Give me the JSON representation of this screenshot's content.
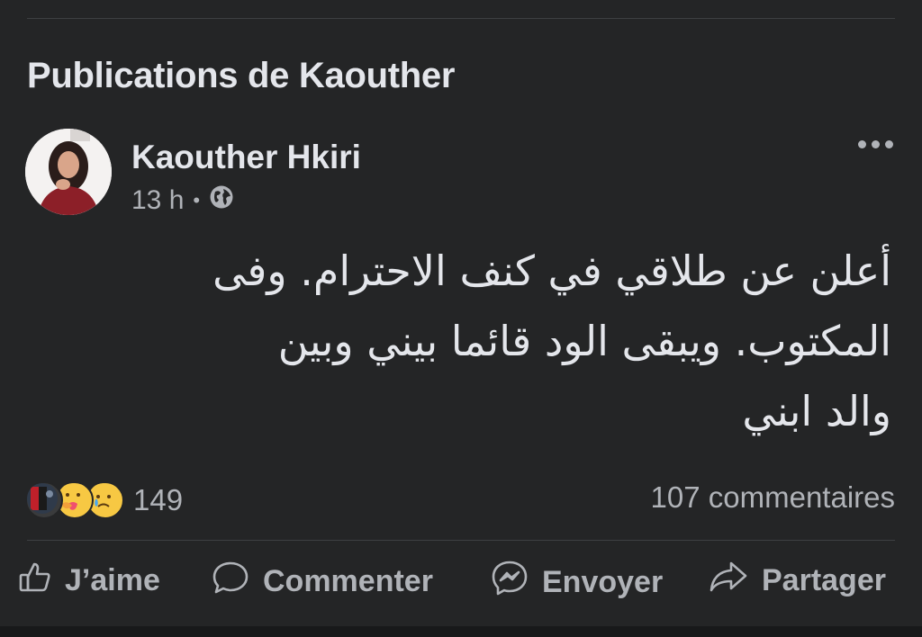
{
  "section": {
    "title": "Publications de Kaouther"
  },
  "post": {
    "author": "Kaouther Hkiri",
    "time": "13 h",
    "privacy_icon": "globe-icon",
    "lines": [
      "أعلن عن طلاقي في كنف الاحترام. وفى",
      "المكتوب. ويبقى الود قائما بيني وبين",
      "والد ابني"
    ],
    "reactions": {
      "icons": [
        "flag-reaction-icon",
        "care-icon",
        "sad-icon"
      ],
      "count": "149"
    },
    "comments": "107 commentaires"
  },
  "actions": {
    "like": "J’aime",
    "comment": "Commenter",
    "send": "Envoyer",
    "share": "Partager"
  },
  "colors": {
    "background": "#242526",
    "text": "#e4e6eb",
    "secondary": "#b0b3b8",
    "divider": "#3e4042"
  }
}
